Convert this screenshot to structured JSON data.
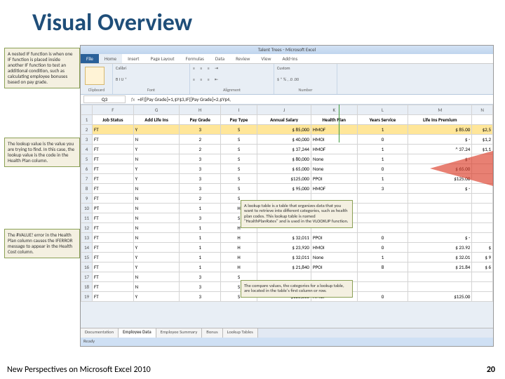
{
  "slide": {
    "title": "Visual Overview",
    "footer_left": "New Perspectives on Microsoft Excel 2010",
    "page_num": "20"
  },
  "win": {
    "title": "Talent Trees - Microsoft Excel"
  },
  "tabs": {
    "file": "File",
    "home": "Home",
    "insert": "Insert",
    "page": "Page Layout",
    "formulas": "Formulas",
    "data": "Data",
    "review": "Review",
    "view": "View",
    "addins": "Add-Ins"
  },
  "groups": {
    "clipboard": "Clipboard",
    "font": "Font",
    "alignment": "Alignment",
    "number": "Number",
    "fontname": "Calibri",
    "format": "Custom",
    "btns": "B  I  U ˅"
  },
  "fbar": {
    "cell": "Q3",
    "fx": "fx",
    "formula": "=IF([Pay Grade]=1,$Y$3,IF([Pay Grade]=2,$Y$4,"
  },
  "cols": [
    "",
    "F",
    "G",
    "H",
    "I",
    "J",
    "K",
    "L",
    "M",
    "N"
  ],
  "h": {
    "F": "Job Status",
    "G": "Add Life Ins",
    "H": "Pay Grade",
    "I": "Pay Type",
    "J": "Annual Salary",
    "K": "Health Plan",
    "L": "Years Service",
    "M": "Life Ins Premium",
    "N": ""
  },
  "rows": [
    {
      "r": "2",
      "F": "FT",
      "G": "Y",
      "H": "3",
      "I": "S",
      "J": "$  85,000",
      "K": "HMOF",
      "L": "1",
      "M": "$  85.00",
      "N": "$2,5",
      "sel": true
    },
    {
      "r": "3",
      "F": "FT",
      "G": "N",
      "H": "2",
      "I": "S",
      "J": "$  40,000",
      "K": "HMOI",
      "L": "0",
      "M": "$     -",
      "N": "$1,2"
    },
    {
      "r": "4",
      "F": "FT",
      "G": "Y",
      "H": "2",
      "I": "S",
      "J": "$  37,244",
      "K": "HMOF",
      "L": "1",
      "M": "^ 37.24",
      "N": "$1,1"
    },
    {
      "r": "5",
      "F": "FT",
      "G": "N",
      "H": "3",
      "I": "S",
      "J": "$  80,000",
      "K": "None",
      "L": "1",
      "M": "$     -",
      "N": ""
    },
    {
      "r": "6",
      "F": "FT",
      "G": "Y",
      "H": "3",
      "I": "S",
      "J": "$  65,000",
      "K": "None",
      "L": "0",
      "M": "$  65.00",
      "N": ""
    },
    {
      "r": "7",
      "F": "FT",
      "G": "Y",
      "H": "3",
      "I": "S",
      "J": "$125,000",
      "K": "PPOI",
      "L": "1",
      "M": "$125.00",
      "N": ""
    },
    {
      "r": "8",
      "F": "FT",
      "G": "N",
      "H": "3",
      "I": "S",
      "J": "$  95,000",
      "K": "HMOF",
      "L": "3",
      "M": "$     -",
      "N": ""
    },
    {
      "r": "9",
      "F": "FT",
      "G": "N",
      "H": "2",
      "I": "S",
      "J": "",
      "K": "",
      "L": "",
      "M": "",
      "N": ""
    },
    {
      "r": "10",
      "F": "PT",
      "G": "N",
      "H": "1",
      "I": "H",
      "J": "",
      "K": "",
      "L": "",
      "M": "",
      "N": ""
    },
    {
      "r": "11",
      "F": "FT",
      "G": "N",
      "H": "3",
      "I": "S",
      "J": "",
      "K": "",
      "L": "",
      "M": "",
      "N": ""
    },
    {
      "r": "12",
      "F": "FT",
      "G": "N",
      "H": "1",
      "I": "H",
      "J": "",
      "K": "",
      "L": "",
      "M": "",
      "N": ""
    },
    {
      "r": "13",
      "F": "FT",
      "G": "N",
      "H": "1",
      "I": "H",
      "J": "$  32,011",
      "K": "PPOI",
      "L": "0",
      "M": "$     -",
      "N": ""
    },
    {
      "r": "14",
      "F": "FT",
      "G": "Y",
      "H": "1",
      "I": "H",
      "J": "$  23,920",
      "K": "HMOI",
      "L": "0",
      "M": "$  23.92",
      "N": "$"
    },
    {
      "r": "15",
      "F": "FT",
      "G": "Y",
      "H": "1",
      "I": "H",
      "J": "$  32,011",
      "K": "None",
      "L": "1",
      "M": "$  32.01",
      "N": "$    9"
    },
    {
      "r": "16",
      "F": "FT",
      "G": "Y",
      "H": "1",
      "I": "H",
      "J": "$  21,840",
      "K": "PPOI",
      "L": "8",
      "M": "$  21.84",
      "N": "$    6"
    },
    {
      "r": "17",
      "F": "FT",
      "G": "N",
      "H": "3",
      "I": "S",
      "J": "",
      "K": "",
      "L": "",
      "M": "",
      "N": ""
    },
    {
      "r": "18",
      "F": "FT",
      "G": "N",
      "H": "3",
      "I": "S",
      "J": "",
      "K": "",
      "L": "",
      "M": "",
      "N": ""
    },
    {
      "r": "19",
      "F": "FT",
      "G": "Y",
      "H": "3",
      "I": "S",
      "J": "$125,000",
      "K": "HMOF",
      "L": "0",
      "M": "$125.00",
      "N": ""
    }
  ],
  "sheets": {
    "doc": "Documentation",
    "emp": "Employee Data",
    "sum": "Employee Summary",
    "bon": "Bonus",
    "look": "Lookup Tables"
  },
  "status": "Ready",
  "co": {
    "nested": "A nested IF function is when one IF function is placed inside another IF function to test an additional condition, such as calculating employee bonuses based on pay grade.",
    "lookup": "The lookup value is the value you are trying to find. In this case, the lookup value is the code in the Health Plan column.",
    "error": "The #VALUE! error in the Health Plan column causes the IFERROR message to appear in the Health Cost column.",
    "table": "A lookup table is a table that organizes data that you want to retrieve into different categories, such as health plan codes. This lookup table is named \"HealthPlanRates\" and is used in the VLOOKUP function.",
    "compare": "The compare values, the categories for a lookup table, are located in the table's first column or row."
  }
}
